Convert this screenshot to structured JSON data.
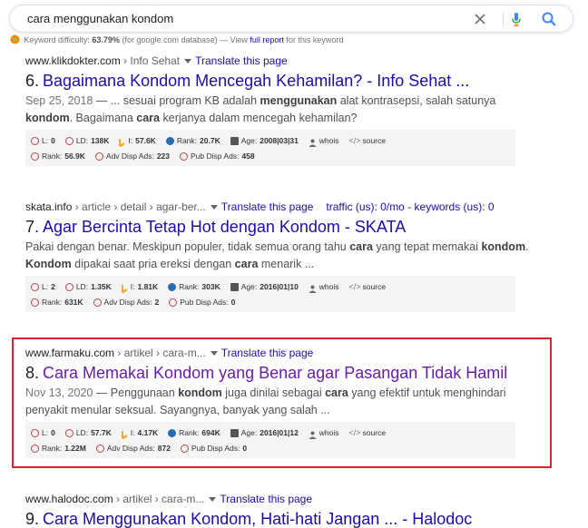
{
  "search": {
    "query": "cara menggunakan kondom"
  },
  "keyword_difficulty": {
    "label": "Keyword difficulty:",
    "value": "63.79%",
    "scope": "(for google.com database) — View",
    "link": "full report",
    "suffix": "for this keyword"
  },
  "colors": {
    "link": "#1a0dab",
    "visited": "#681da8",
    "highlight": "#d9262c"
  },
  "results": [
    {
      "domain": "www.klikdokter.com",
      "path": " › Info Sehat",
      "translate": "Translate this page",
      "num": "6.",
      "title": "Bagaimana Kondom Mencegah Kehamilan? - Info Sehat ...",
      "date": "Sep 25, 2018",
      "snippet": [
        {
          "t": " — ... sesuai program KB adalah "
        },
        {
          "t": "menggunakan",
          "b": true
        },
        {
          "t": " alat kontrasepsi, salah satunya "
        },
        {
          "t": "kondom",
          "b": true
        },
        {
          "t": ". Bagaimana "
        },
        {
          "t": "cara",
          "b": true
        },
        {
          "t": " kerjanya dalam mencegah kehamilan?"
        }
      ],
      "seo": {
        "L": "0",
        "LD": "138K",
        "I": "57.6K",
        "Rank": "20.7K",
        "Age": "2008|03|31",
        "whois": "whois",
        "source": "source",
        "Rank2": "56.9K",
        "Adv": "223",
        "Pub": "458"
      }
    },
    {
      "domain": "skata.info",
      "path": " › article › detail › agar-ber...",
      "translate": "Translate this page",
      "traffic": "traffic (us): 0/mo - keywords (us): 0",
      "num": "7.",
      "title": "Agar Bercinta Tetap Hot dengan Kondom - SKATA",
      "snippet": [
        {
          "t": "Pakai dengan benar. Meskipun populer, tidak semua orang tahu "
        },
        {
          "t": "cara",
          "b": true
        },
        {
          "t": " yang tepat memakai "
        },
        {
          "t": "kondom",
          "b": true
        },
        {
          "t": ". "
        },
        {
          "t": "Kondom",
          "b": true
        },
        {
          "t": " dipakai saat pria ereksi dengan "
        },
        {
          "t": "cara",
          "b": true
        },
        {
          "t": " menarik ..."
        }
      ],
      "seo": {
        "L": "2",
        "LD": "1.35K",
        "I": "1.81K",
        "Rank": "303K",
        "Age": "2016|01|10",
        "whois": "whois",
        "source": "source",
        "Rank2": "631K",
        "Adv": "2",
        "Pub": "0"
      }
    },
    {
      "domain": "www.farmaku.com",
      "path": " › artikel › cara-m...",
      "translate": "Translate this page",
      "num": "8.",
      "title": "Cara Memakai Kondom yang Benar agar Pasangan Tidak Hamil",
      "visited": true,
      "date": "Nov 13, 2020",
      "snippet": [
        {
          "t": " — Penggunaan "
        },
        {
          "t": "kondom",
          "b": true
        },
        {
          "t": " juga dinilai sebagai "
        },
        {
          "t": "cara",
          "b": true
        },
        {
          "t": " yang efektif untuk menghindari penyakit menular seksual. Sayangnya, banyak yang salah ..."
        }
      ],
      "seo": {
        "L": "0",
        "LD": "57.7K",
        "I": "4.17K",
        "Rank": "694K",
        "Age": "2016|01|12",
        "whois": "whois",
        "source": "source",
        "Rank2": "1.22M",
        "Adv": "872",
        "Pub": "0"
      }
    },
    {
      "domain": "www.halodoc.com",
      "path": " › artikel › cara-m...",
      "translate": "Translate this page",
      "num": "9.",
      "title": "Cara Menggunakan Kondom, Hati-hati Jangan ... - Halodoc"
    }
  ],
  "seo_labels": {
    "L": "L:",
    "LD": "LD:",
    "I": "I:",
    "Rank": "Rank:",
    "Age": "Age:",
    "Rank2": "Rank:",
    "Adv": "Adv Disp Ads:",
    "Pub": "Pub Disp Ads:"
  }
}
